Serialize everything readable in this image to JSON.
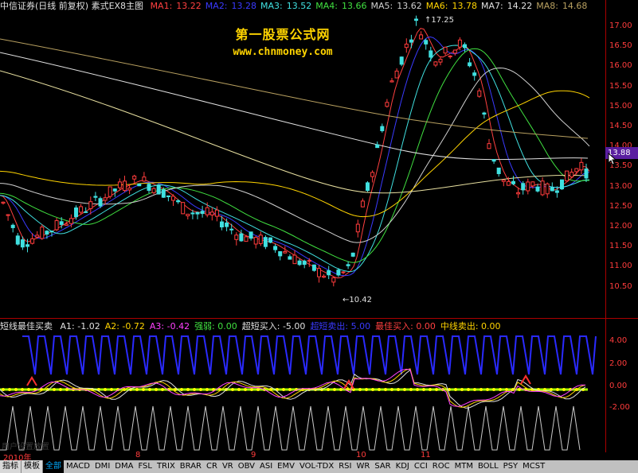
{
  "header": {
    "title": "中信证券(日线 前复权) 素式EX8主图",
    "ma": [
      {
        "label": "MA1:",
        "value": "13.22",
        "color": "#ff4040"
      },
      {
        "label": "MA2:",
        "value": "13.28",
        "color": "#3a3aff"
      },
      {
        "label": "MA3:",
        "value": "13.52",
        "color": "#40e0e0"
      },
      {
        "label": "MA4:",
        "value": "13.66",
        "color": "#40e040"
      },
      {
        "label": "MA5:",
        "value": "13.62",
        "color": "#d0d0d0"
      },
      {
        "label": "MA6:",
        "value": "13.78",
        "color": "#ffd400"
      },
      {
        "label": "MA7:",
        "value": "14.22",
        "color": "#e0e0e0"
      },
      {
        "label": "MA8:",
        "value": "14.68",
        "color": "#b8a060"
      }
    ]
  },
  "watermark": {
    "line1": "第一股票公式网",
    "line2": "www.chnmoney.com"
  },
  "price_axis": {
    "ticks": [
      "17.00",
      "16.50",
      "16.00",
      "15.50",
      "15.00",
      "14.50",
      "14.00",
      "13.50",
      "13.00",
      "12.50",
      "12.00",
      "11.50",
      "11.00",
      "10.50"
    ],
    "current_price": "13.88"
  },
  "price_annotations": {
    "high": "17.25",
    "low": "←10.42"
  },
  "indicator": {
    "title": "短线最佳买卖",
    "items": [
      {
        "label": "A1: -1.02",
        "color": "#e0e0e0"
      },
      {
        "label": "A2: -0.72",
        "color": "#ffd400"
      },
      {
        "label": "A3: -0.42",
        "color": "#ff40ff"
      },
      {
        "label": "强弱: 0.00",
        "color": "#40e040"
      },
      {
        "label": "超短买入: -5.00",
        "color": "#e0e0e0"
      },
      {
        "label": "超短卖出: 5.00",
        "color": "#3a3aff"
      },
      {
        "label": "最佳买入: 0.00",
        "color": "#ff4040"
      },
      {
        "label": "中线卖出: 0.00",
        "color": "#ffd400"
      }
    ],
    "axis_ticks": [
      "4.00",
      "2.00",
      "0.00",
      "-2.00"
    ]
  },
  "dates": {
    "year": "2010年",
    "m8": "8",
    "m9": "9",
    "m10": "10",
    "m11": "11"
  },
  "faded_label": "用户设置放置",
  "tabs": [
    "指标",
    "模板",
    "全部",
    "MACD",
    "DMI",
    "DMA",
    "FSL",
    "TRIX",
    "BRAR",
    "CR",
    "VR",
    "OBV",
    "ASI",
    "EMV",
    "VOL-TDX",
    "RSI",
    "WR",
    "SAR",
    "KDJ",
    "CCI",
    "ROC",
    "MTM",
    "BOLL",
    "PSY",
    "MCST"
  ],
  "colors": {
    "up": "#ff3c3c",
    "down": "#40e0e0",
    "axis": "#aa0000",
    "accent": "#5a1ea0"
  }
}
